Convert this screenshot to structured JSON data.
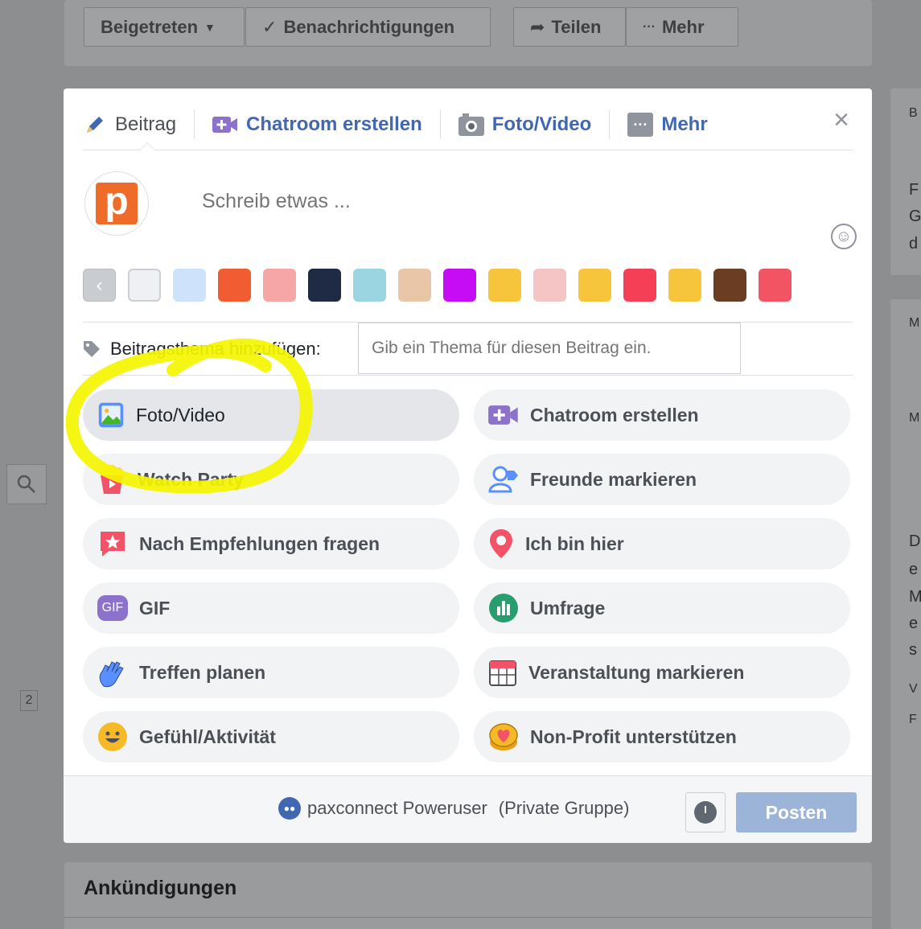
{
  "background": {
    "top_buttons": [
      "Beigetreten",
      "Benachrichtigungen",
      "Teilen",
      "Mehr"
    ],
    "bottom_title": "Ankündigungen",
    "badge": "2",
    "right_text": [
      "B",
      "F",
      "G",
      "d",
      "M",
      "M",
      "D",
      "e",
      "M",
      "e",
      "s",
      "V",
      "F"
    ]
  },
  "composer": {
    "tabs": [
      {
        "label": "Beitrag",
        "icon": "pencil-icon"
      },
      {
        "label": "Chatroom erstellen",
        "icon": "video-plus-icon"
      },
      {
        "label": "Foto/Video",
        "icon": "camera-icon"
      },
      {
        "label": "Mehr",
        "icon": "more-icon"
      }
    ],
    "close": "×",
    "avatar_letter": "p",
    "placeholder": "Schreib etwas ...",
    "swatch_colors": [
      "#eef0f3",
      "#cfe2fb",
      "#f25c32",
      "#f7a6a7",
      "#1f2a44",
      "#9bd5e2",
      "#e8c6a7",
      "#c60cf5",
      "#f6c53c",
      "#f5c4c5",
      "#f6c53c",
      "#f43f56",
      "#f6c53c",
      "#6b3e23",
      "#f25463"
    ],
    "topic": {
      "label": "Beitragsthema hinzufügen:",
      "placeholder": "Gib ein Thema für diesen Beitrag ein."
    },
    "options": [
      {
        "label": "Foto/Video",
        "icon": "photo-icon",
        "color": "#5890ff"
      },
      {
        "label": "Chatroom erstellen",
        "icon": "video-plus-icon",
        "color": "#8c72cb"
      },
      {
        "label": "Watch Party",
        "icon": "popcorn-icon",
        "color": "#f35369"
      },
      {
        "label": "Freunde markieren",
        "icon": "tag-friends-icon",
        "color": "#5890ff"
      },
      {
        "label": "Nach Empfehlungen fragen",
        "icon": "star-bubble-icon",
        "color": "#f35369"
      },
      {
        "label": "Ich bin hier",
        "icon": "location-pin-icon",
        "color": "#f35369"
      },
      {
        "label": "GIF",
        "icon": "gif-icon",
        "color": "#8c72cb"
      },
      {
        "label": "Umfrage",
        "icon": "poll-icon",
        "color": "#2a9d6f"
      },
      {
        "label": "Treffen planen",
        "icon": "wave-hand-icon",
        "color": "#5890ff"
      },
      {
        "label": "Veranstaltung markieren",
        "icon": "calendar-icon",
        "color": "#f35369"
      },
      {
        "label": "Gefühl/Aktivität",
        "icon": "smiley-icon",
        "color": "#f7b928"
      },
      {
        "label": "Non-Profit unterstützen",
        "icon": "heart-coin-icon",
        "color": "#f7b928"
      }
    ],
    "footer": {
      "group_name": "paxconnect Poweruser",
      "group_type": "(Private Gruppe)",
      "post_label": "Posten"
    }
  },
  "highlight": {
    "color": "#f5f500"
  }
}
